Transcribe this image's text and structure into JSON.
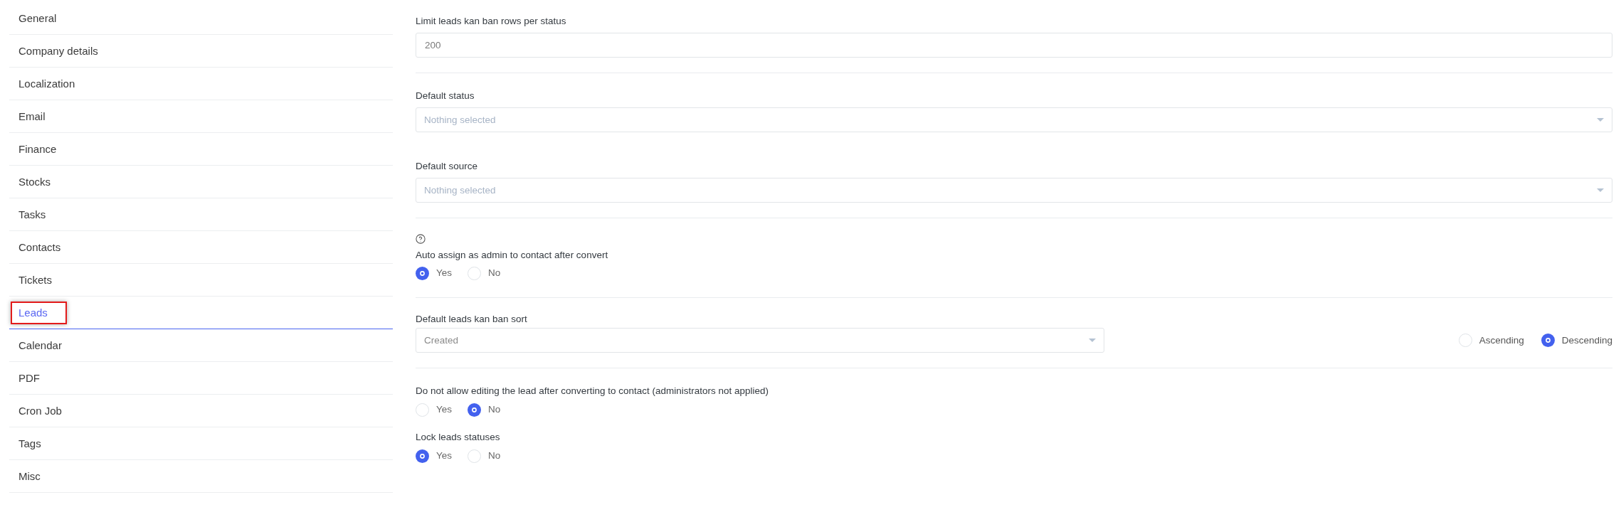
{
  "sidebar": {
    "items": [
      {
        "label": "General",
        "selected": false,
        "highlighted": false
      },
      {
        "label": "Company details",
        "selected": false,
        "highlighted": false
      },
      {
        "label": "Localization",
        "selected": false,
        "highlighted": false
      },
      {
        "label": "Email",
        "selected": false,
        "highlighted": false
      },
      {
        "label": "Finance",
        "selected": false,
        "highlighted": false
      },
      {
        "label": "Stocks",
        "selected": false,
        "highlighted": false
      },
      {
        "label": "Tasks",
        "selected": false,
        "highlighted": false
      },
      {
        "label": "Contacts",
        "selected": false,
        "highlighted": false
      },
      {
        "label": "Tickets",
        "selected": false,
        "highlighted": false
      },
      {
        "label": "Leads",
        "selected": true,
        "highlighted": true
      },
      {
        "label": "Calendar",
        "selected": false,
        "highlighted": false
      },
      {
        "label": "PDF",
        "selected": false,
        "highlighted": false
      },
      {
        "label": "Cron Job",
        "selected": false,
        "highlighted": false
      },
      {
        "label": "Tags",
        "selected": false,
        "highlighted": false
      },
      {
        "label": "Misc",
        "selected": false,
        "highlighted": false
      }
    ]
  },
  "sections": [
    {
      "fields": [
        {
          "kind": "input",
          "label": "Limit leads kan ban rows per status",
          "value": "200"
        }
      ]
    },
    {
      "fields": [
        {
          "kind": "select",
          "label": "Default status",
          "placeholder": "Nothing selected"
        },
        {
          "kind": "select",
          "label": "Default source",
          "placeholder": "Nothing selected"
        }
      ]
    },
    {
      "fields": [
        {
          "kind": "radio",
          "help": true,
          "label": "Auto assign as admin to contact after convert",
          "options": [
            {
              "label": "Yes",
              "selected": true
            },
            {
              "label": "No",
              "selected": false
            }
          ]
        }
      ]
    },
    {
      "fields": [
        {
          "kind": "sort",
          "label": "Default leads kan ban sort",
          "value": "Created",
          "options": [
            {
              "label": "Ascending",
              "selected": false
            },
            {
              "label": "Descending",
              "selected": true
            }
          ]
        }
      ]
    },
    {
      "fields": [
        {
          "kind": "radio",
          "help": false,
          "label": "Do not allow editing the lead after converting to contact (administrators not applied)",
          "options": [
            {
              "label": "Yes",
              "selected": false
            },
            {
              "label": "No",
              "selected": true
            }
          ]
        },
        {
          "kind": "radio",
          "help": false,
          "label": "Lock leads statuses",
          "options": [
            {
              "label": "Yes",
              "selected": true
            },
            {
              "label": "No",
              "selected": false
            }
          ]
        }
      ]
    }
  ]
}
